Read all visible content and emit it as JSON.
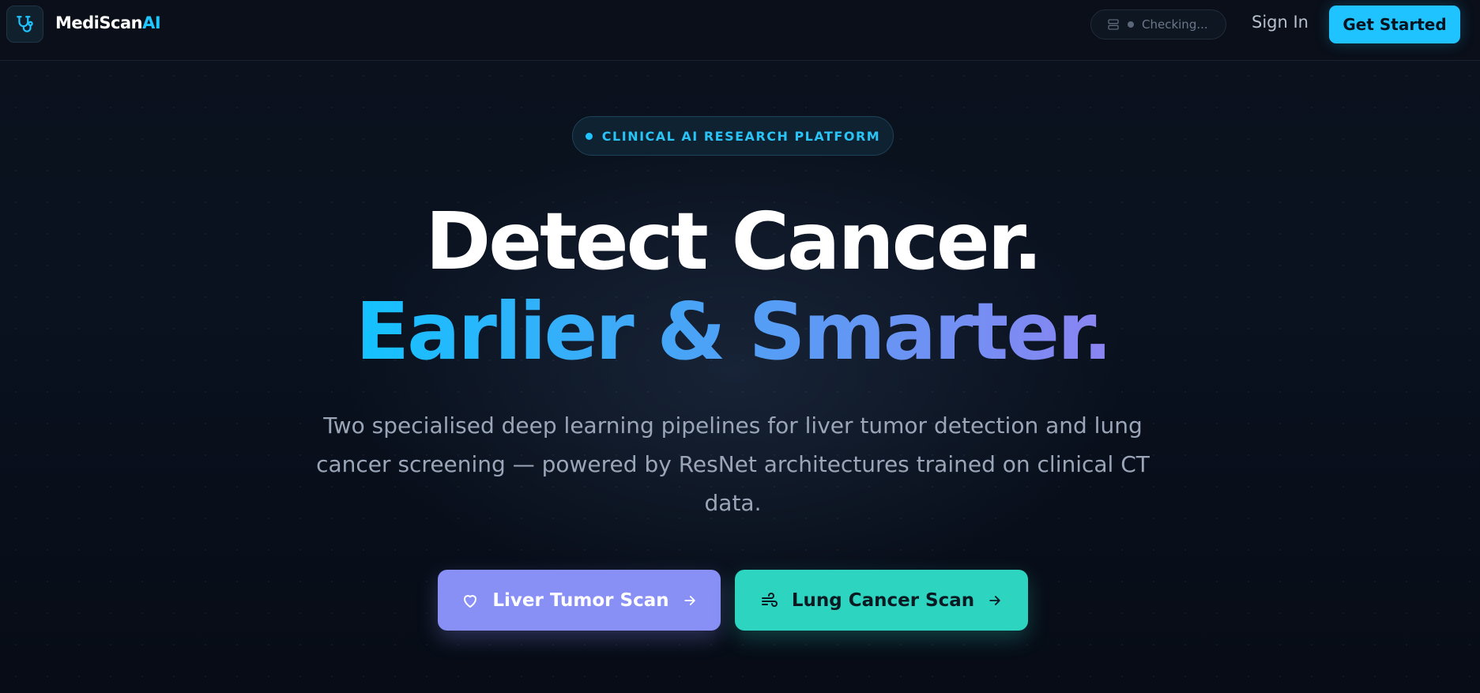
{
  "header": {
    "brand_name": "MediScan",
    "brand_suffix": "AI",
    "logo_icon": "stethoscope-icon",
    "server_status": "Checking...",
    "server_icon": "server-icon",
    "signin_label": "Sign In",
    "get_started_label": "Get Started"
  },
  "hero": {
    "badge": "CLINICAL AI RESEARCH PLATFORM",
    "headline_line1": "Detect Cancer.",
    "headline_line2": "Earlier & Smarter.",
    "description": "Two specialised deep learning pipelines for liver tumor detection and lung cancer screening — powered by ResNet architectures trained on clinical CT data.",
    "buttons": [
      {
        "label": "Liver Tumor Scan",
        "icon": "heart-icon",
        "trailing_icon": "arrow-right-icon"
      },
      {
        "label": "Lung Cancer Scan",
        "icon": "wind-icon",
        "trailing_icon": "arrow-right-icon"
      }
    ]
  },
  "colors": {
    "accent": "#1ec3ff",
    "liver_button": "#8890f5",
    "lung_button": "#2dd4bf",
    "background": "#0a0f1a"
  }
}
